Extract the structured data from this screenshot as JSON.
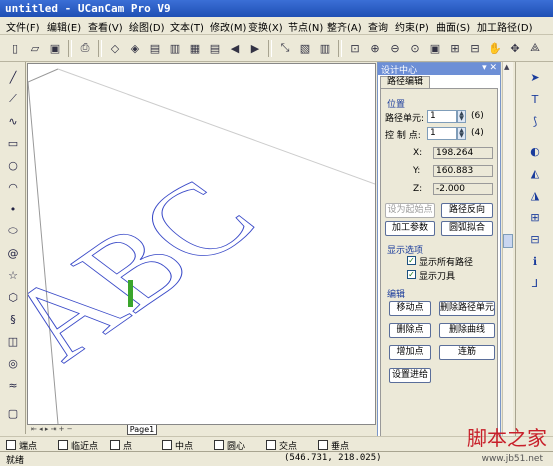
{
  "window": {
    "title": "untitled - UCanCam Pro V9"
  },
  "menu": [
    "文件(F)",
    "编辑(E)",
    "查看(V)",
    "绘图(D)",
    "文本(T)",
    "修改(M)",
    "变换(X)",
    "节点(N)",
    "整齐(A)",
    "查询",
    "约束(P)",
    "曲面(S)",
    "加工路径(D)"
  ],
  "canvas": {
    "text": "ABC",
    "page_tab": "Page1"
  },
  "panel": {
    "title": "设计中心",
    "tab": "路径编辑",
    "position": {
      "label": "位置",
      "path_unit_label": "路径单元:",
      "path_unit_value": "1",
      "path_unit_count": "(6)",
      "ctrl_point_label": "控 制 点:",
      "ctrl_point_value": "1",
      "ctrl_point_count": "(4)",
      "x_label": "X:",
      "x_value": "198.264",
      "y_label": "Y:",
      "y_value": "160.883",
      "z_label": "Z:",
      "z_value": "-2.000"
    },
    "buttons": {
      "set_start": "设为起始点",
      "reverse": "路径反向",
      "params": "加工参数",
      "arc_fit": "圆弧拟合"
    },
    "display": {
      "label": "显示选项",
      "show_all": "显示所有路径",
      "show_tool": "显示刀具"
    },
    "edit": {
      "label": "编辑",
      "move_point": "移动点",
      "delete_unit": "删除路径单元",
      "delete_point": "删除点",
      "delete_curve": "删除曲线",
      "add_point": "增加点",
      "connect": "连筋",
      "set_feed": "设置进给"
    }
  },
  "snap": [
    "端点",
    "临近点",
    "点",
    "中点",
    "圆心",
    "交点",
    "垂点"
  ],
  "status": {
    "ready": "就绪",
    "coords": "(546.731,  218.025)"
  },
  "watermark": {
    "brand": "脚本之家",
    "url": "www.jb51.net"
  }
}
